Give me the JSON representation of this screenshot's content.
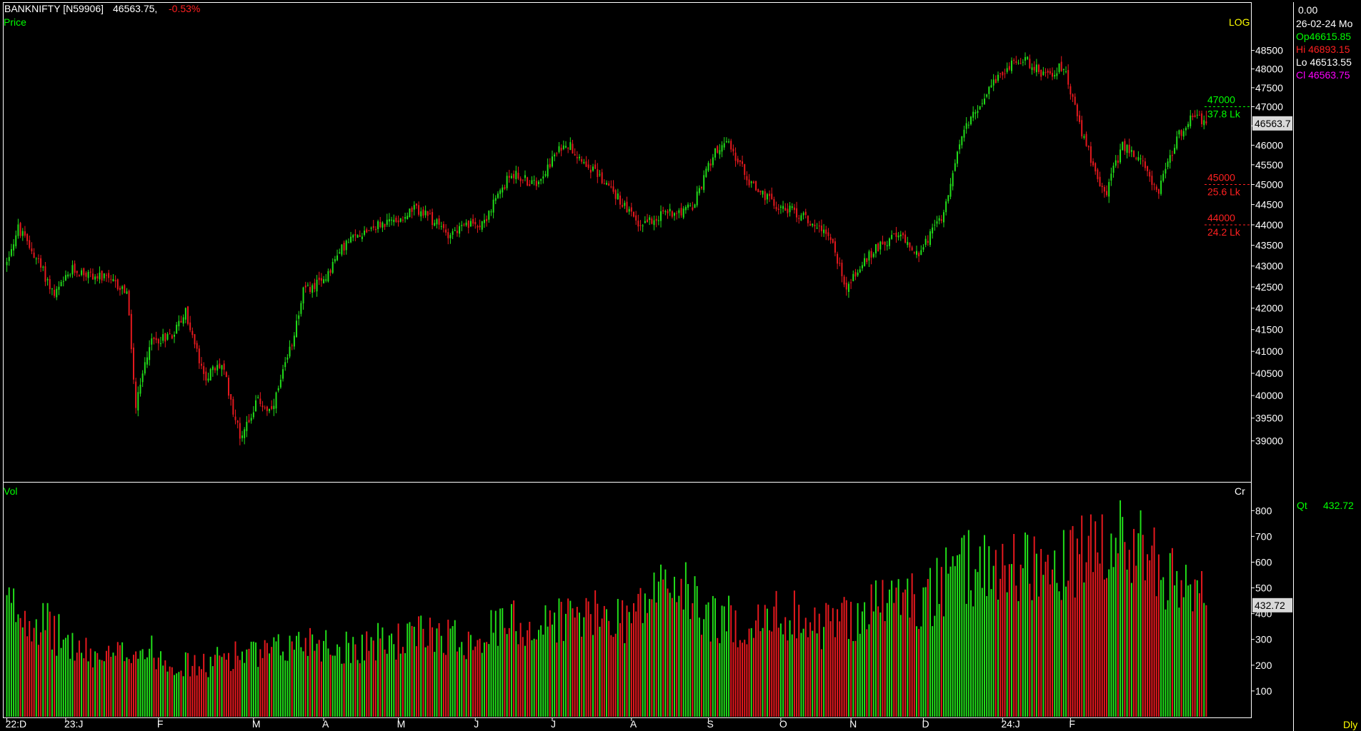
{
  "header": {
    "symbol": "BANKNIFTY [N59906]",
    "last": "46563.75,",
    "change": "-0.53%",
    "price_label": "Price",
    "log_label": "LOG",
    "vol_label": "Vol",
    "vol_unit": "Cr",
    "period": "Dly"
  },
  "info_panel": {
    "top_value": "0.00",
    "date": "26-02-24 Mo",
    "open": "Op46615.85",
    "high": "Hi  46893.15",
    "low": "Lo 46513.55",
    "close": "Cl  46563.75",
    "qty_label": "Qt",
    "qty_value": "432.72"
  },
  "price_marker": "46563.7",
  "vol_marker": "432.72",
  "levels": [
    {
      "price": 47000,
      "label": "47000",
      "sub": "37.8 Lk",
      "color": "#00ff00"
    },
    {
      "price": 45000,
      "label": "45000",
      "sub": "25.6 Lk",
      "color": "#ff2020"
    },
    {
      "price": 44000,
      "label": "44000",
      "sub": "24.2 Lk",
      "color": "#ff2020"
    }
  ],
  "colors": {
    "up": "#22e01a",
    "down": "#e8191e",
    "axis": "#ffffff",
    "label_green": "#00ff00"
  },
  "chart_data": {
    "type": "candlestick+volume",
    "price_scale": "log",
    "price_axis": {
      "ylim": [
        38500,
        48900
      ],
      "ticks": [
        39000,
        39500,
        40000,
        40500,
        41000,
        41500,
        42000,
        42500,
        43000,
        43500,
        44000,
        44500,
        45000,
        45500,
        46000,
        46500,
        47000,
        47500,
        48000,
        48500
      ]
    },
    "volume_axis": {
      "ylim": [
        0,
        870
      ],
      "ticks": [
        100,
        200,
        300,
        400,
        500,
        600,
        700,
        800
      ],
      "unit": "Cr"
    },
    "x_labels": [
      "22:D",
      "23:J",
      "F",
      "M",
      "A",
      "M",
      "J",
      "J",
      "A",
      "S",
      "O",
      "N",
      "D",
      "24:J",
      "F"
    ],
    "close_path": [
      [
        0,
        43000
      ],
      [
        6,
        43900
      ],
      [
        14,
        43200
      ],
      [
        22,
        42300
      ],
      [
        30,
        42900
      ],
      [
        44,
        42700
      ],
      [
        54,
        42400
      ],
      [
        58,
        39700
      ],
      [
        64,
        41200
      ],
      [
        74,
        41400
      ],
      [
        80,
        41900
      ],
      [
        88,
        40400
      ],
      [
        96,
        40700
      ],
      [
        104,
        39100
      ],
      [
        112,
        39900
      ],
      [
        118,
        39600
      ],
      [
        126,
        41000
      ],
      [
        132,
        42400
      ],
      [
        140,
        42600
      ],
      [
        150,
        43500
      ],
      [
        160,
        43900
      ],
      [
        172,
        44100
      ],
      [
        182,
        44400
      ],
      [
        196,
        43800
      ],
      [
        212,
        44100
      ],
      [
        224,
        45300
      ],
      [
        234,
        45000
      ],
      [
        248,
        46100
      ],
      [
        256,
        45600
      ],
      [
        268,
        44900
      ],
      [
        280,
        44000
      ],
      [
        292,
        44300
      ],
      [
        304,
        44400
      ],
      [
        314,
        45900
      ],
      [
        320,
        46000
      ],
      [
        330,
        45000
      ],
      [
        340,
        44500
      ],
      [
        350,
        44300
      ],
      [
        364,
        43800
      ],
      [
        372,
        42500
      ],
      [
        380,
        43100
      ],
      [
        388,
        43600
      ],
      [
        396,
        43700
      ],
      [
        404,
        43300
      ],
      [
        414,
        44200
      ],
      [
        424,
        46400
      ],
      [
        432,
        47200
      ],
      [
        442,
        48000
      ],
      [
        450,
        48300
      ],
      [
        460,
        47800
      ],
      [
        468,
        48100
      ],
      [
        476,
        46300
      ],
      [
        486,
        44700
      ],
      [
        494,
        46000
      ],
      [
        502,
        45600
      ],
      [
        510,
        44800
      ],
      [
        518,
        46200
      ],
      [
        526,
        46800
      ],
      [
        530,
        46600
      ]
    ],
    "bars": 531,
    "volume_profile": [
      [
        0,
        420
      ],
      [
        12,
        380
      ],
      [
        24,
        300
      ],
      [
        34,
        240
      ],
      [
        46,
        220
      ],
      [
        56,
        260
      ],
      [
        66,
        240
      ],
      [
        76,
        200
      ],
      [
        88,
        190
      ],
      [
        96,
        230
      ],
      [
        104,
        240
      ],
      [
        112,
        230
      ],
      [
        120,
        250
      ],
      [
        126,
        270
      ],
      [
        134,
        300
      ],
      [
        146,
        260
      ],
      [
        160,
        280
      ],
      [
        176,
        290
      ],
      [
        190,
        330
      ],
      [
        200,
        290
      ],
      [
        212,
        320
      ],
      [
        224,
        360
      ],
      [
        234,
        330
      ],
      [
        244,
        380
      ],
      [
        256,
        380
      ],
      [
        266,
        380
      ],
      [
        276,
        380
      ],
      [
        284,
        450
      ],
      [
        292,
        520
      ],
      [
        300,
        470
      ],
      [
        310,
        380
      ],
      [
        320,
        360
      ],
      [
        330,
        340
      ],
      [
        340,
        380
      ],
      [
        350,
        400
      ],
      [
        356,
        330
      ],
      [
        364,
        360
      ],
      [
        376,
        390
      ],
      [
        388,
        440
      ],
      [
        398,
        460
      ],
      [
        404,
        420
      ],
      [
        414,
        500
      ],
      [
        424,
        560
      ],
      [
        432,
        580
      ],
      [
        442,
        560
      ],
      [
        450,
        600
      ],
      [
        462,
        540
      ],
      [
        472,
        580
      ],
      [
        478,
        640
      ],
      [
        486,
        600
      ],
      [
        494,
        680
      ],
      [
        502,
        640
      ],
      [
        510,
        560
      ],
      [
        520,
        460
      ],
      [
        528,
        470
      ]
    ],
    "last": {
      "open": 46615.85,
      "high": 46893.15,
      "low": 46513.55,
      "close": 46563.75,
      "volume": 432.72
    }
  }
}
